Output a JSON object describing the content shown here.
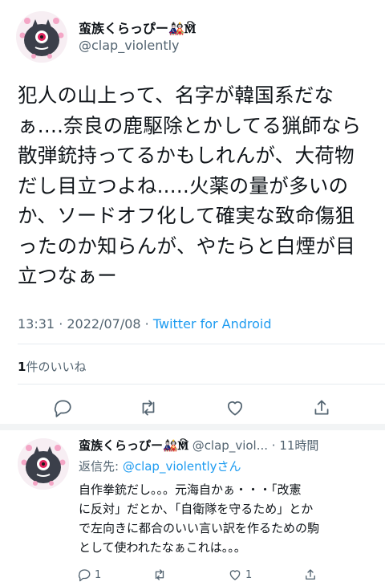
{
  "tweet": {
    "display_name": "蛮族くらっぴー🎎🕅",
    "handle": "@clap_violently",
    "text": "犯人の山上って、名字が韓国系だな\nぁ....奈良の鹿駆除とかしてる猟師なら\n散弾銃持ってるかもしれんが、大荷物\nだし目立つよね.....火薬の量が多いの\nか、ソードオフ化して確実な致命傷狙\nったのか知らんが、やたらと白煙が目\n立つなぁー",
    "time": "13:31",
    "separator": " · ",
    "date": "2022/07/08",
    "source": "Twitter for Android",
    "likes_count": "1",
    "likes_label": "件のいいね"
  },
  "actions": {
    "reply_icon": "reply-icon",
    "retweet_icon": "retweet-icon",
    "like_icon": "heart-icon",
    "share_icon": "share-icon"
  },
  "reply": {
    "display_name": "蛮族くらっぴー🎎🕅",
    "handle": "@clap_viol...",
    "time": " · 11時間",
    "reply_to_prefix": "返信先: ",
    "reply_to_handle": "@clap_violently",
    "reply_to_suffix": "さん",
    "text": "自作拳銃だし。。。元海自かぁ・・・「改憲\nに反対」だとか、「自衛隊を守るため」とか\nで左向きに都合のいい言い訳を作るための駒\nとして使われたなぁこれは。。。",
    "reply_count": "1",
    "like_count": "1"
  },
  "colors": {
    "text": "#0f1419",
    "secondary": "#536471",
    "accent": "#1d9bf0",
    "divider": "#e6ecf0"
  }
}
